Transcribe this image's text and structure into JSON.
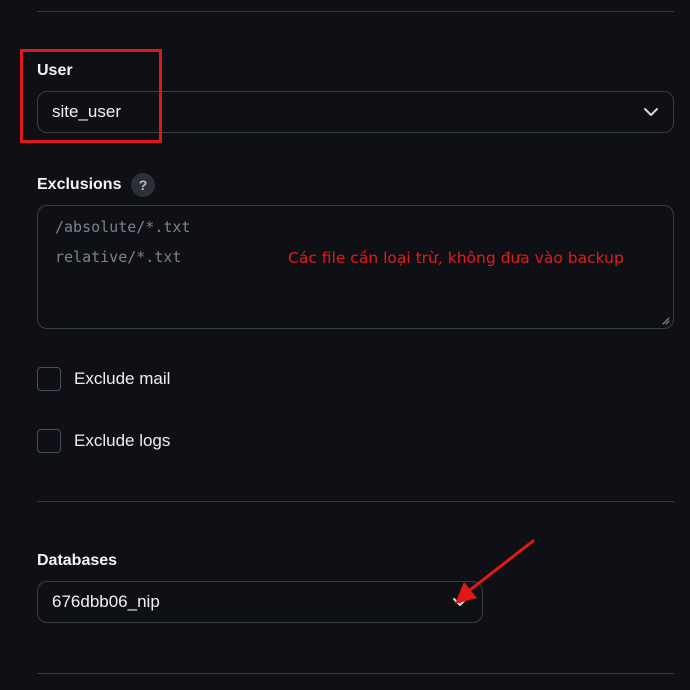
{
  "user": {
    "label": "User",
    "selected_value": "site_user"
  },
  "exclusions": {
    "label": "Exclusions",
    "help_icon": "?",
    "placeholder_lines": [
      "/absolute/*.txt",
      "relative/*.txt"
    ]
  },
  "checkboxes": {
    "exclude_mail": {
      "label": "Exclude mail",
      "checked": false
    },
    "exclude_logs": {
      "label": "Exclude logs",
      "checked": false
    }
  },
  "databases": {
    "label": "Databases",
    "selected_value": "676dbb06_nip"
  },
  "annotation": {
    "text": "Các file cần loại trừ, không đưa vào backup",
    "color": "#e31b1b"
  },
  "icons": [
    "chevron-down-icon",
    "help-icon",
    "resize-grip-icon",
    "annotation-arrow"
  ],
  "colors": {
    "background": "#0f1015",
    "border": "#3a3d46",
    "annotation_red": "#e01818"
  }
}
